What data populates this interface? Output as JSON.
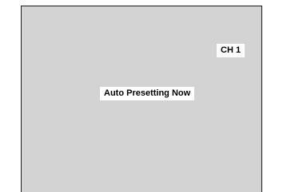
{
  "osd": {
    "channel": "CH 1",
    "status": "Auto Presetting Now"
  }
}
